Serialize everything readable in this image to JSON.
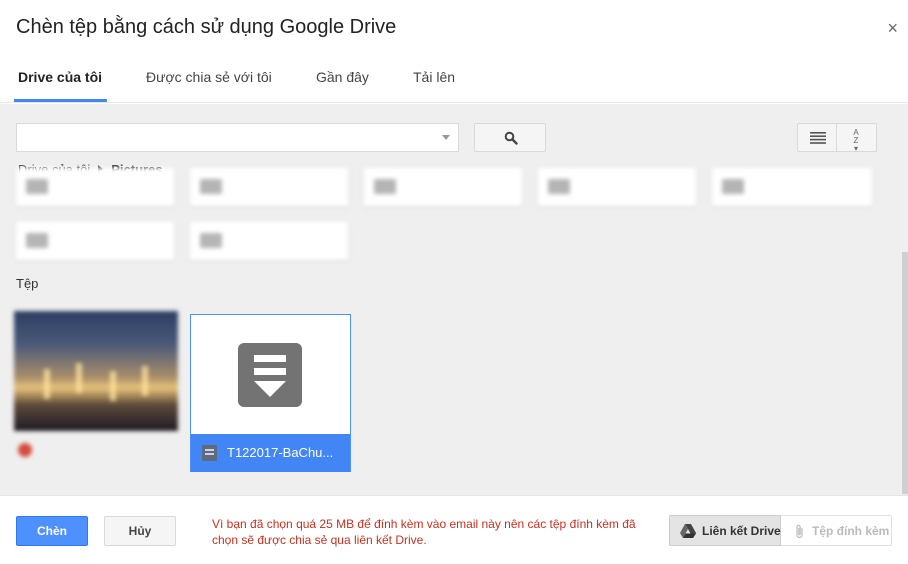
{
  "dialog": {
    "title": "Chèn tệp bằng cách sử dụng Google Drive",
    "close_label": "×"
  },
  "tabs": [
    {
      "label": "Drive của tôi",
      "active": true
    },
    {
      "label": "Được chia sẻ với tôi",
      "active": false
    },
    {
      "label": "Gần đây",
      "active": false
    },
    {
      "label": "Tải lên",
      "active": false
    }
  ],
  "search": {
    "value": "",
    "placeholder": ""
  },
  "breadcrumb": {
    "root": "Drive của tôi",
    "current": "Pictures"
  },
  "files_section": {
    "label": "Tệp",
    "selected_file_name": "T122017-BaChu..."
  },
  "footer": {
    "insert_label": "Chèn",
    "cancel_label": "Hủy",
    "notice": "Vì bạn đã chọn quá 25 MB để đính kèm vào email này nên các tệp đính kèm đã chọn sẽ được chia sẻ qua liên kết Drive.",
    "drive_link_label": "Liên kết Drive",
    "attachment_label": "Tệp đính kèm"
  },
  "colors": {
    "accent": "#4285f4",
    "primary_button": "#4d90fe",
    "notice_text": "#c23321"
  }
}
